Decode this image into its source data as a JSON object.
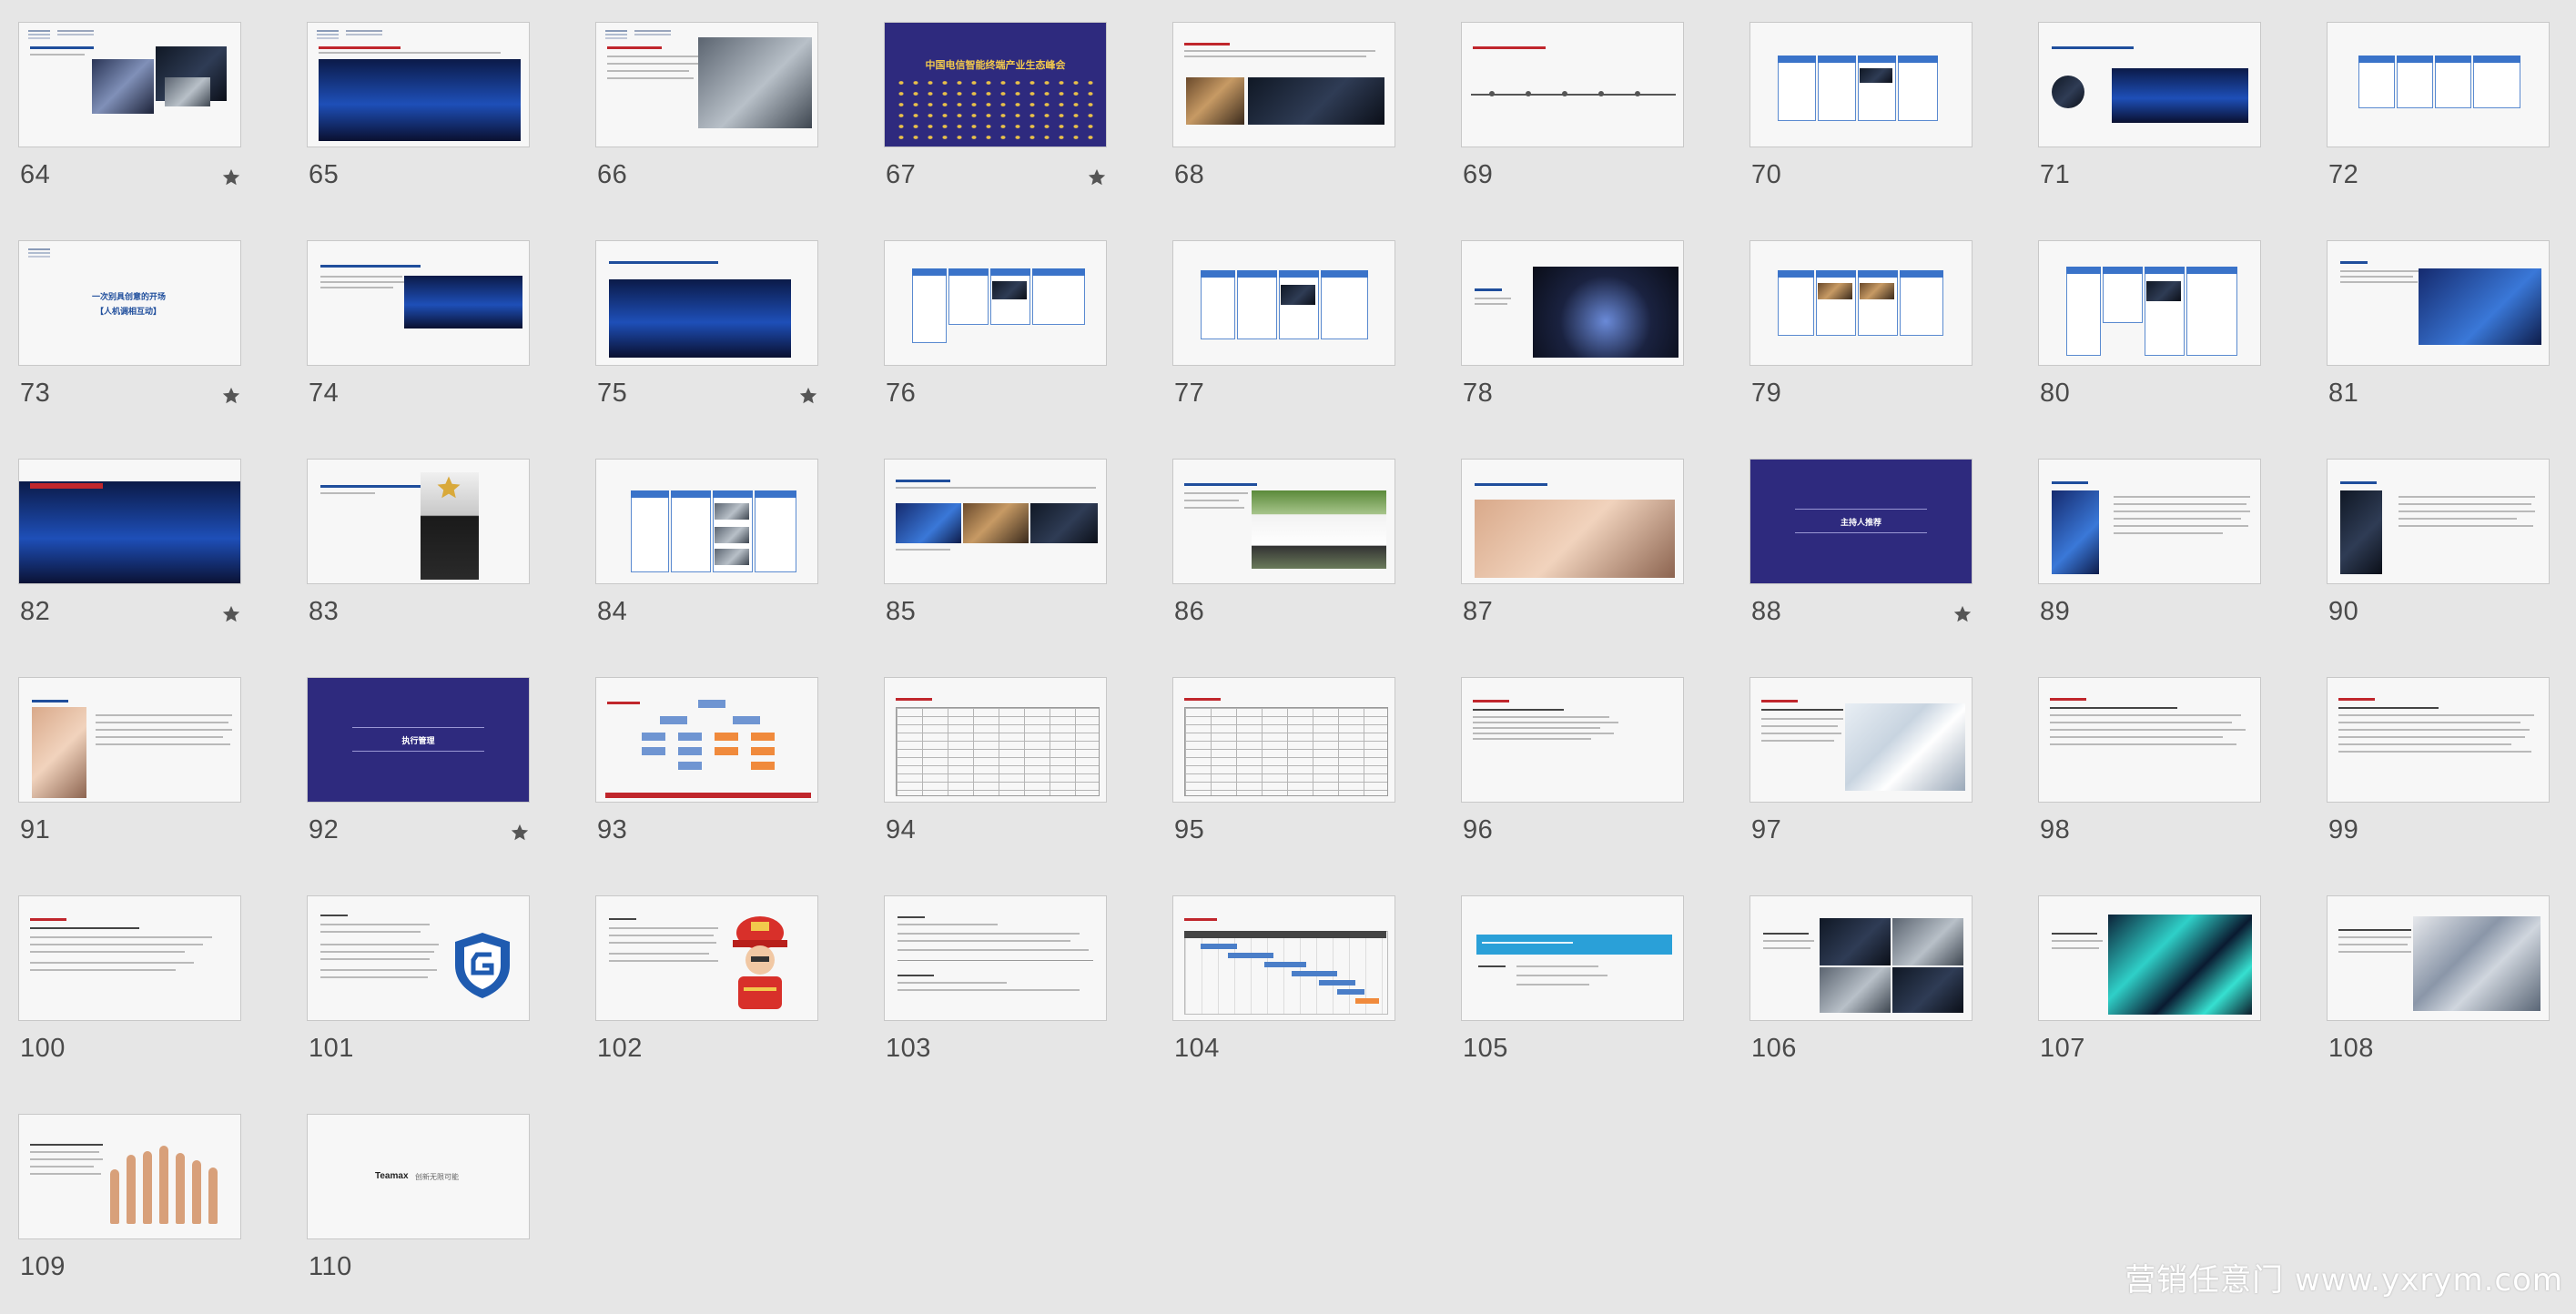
{
  "slides": [
    {
      "number": "64",
      "starred": true
    },
    {
      "number": "65",
      "starred": false
    },
    {
      "number": "66",
      "starred": false
    },
    {
      "number": "67",
      "starred": true,
      "thumb_text": "中国电信智能终端产业生态峰会"
    },
    {
      "number": "68",
      "starred": false
    },
    {
      "number": "69",
      "starred": false
    },
    {
      "number": "70",
      "starred": false
    },
    {
      "number": "71",
      "starred": false
    },
    {
      "number": "72",
      "starred": false
    },
    {
      "number": "73",
      "starred": true,
      "thumb_text": "一次别具创意的开场",
      "thumb_text2": "【人机调相互动】"
    },
    {
      "number": "74",
      "starred": false
    },
    {
      "number": "75",
      "starred": true
    },
    {
      "number": "76",
      "starred": false
    },
    {
      "number": "77",
      "starred": false
    },
    {
      "number": "78",
      "starred": false
    },
    {
      "number": "79",
      "starred": false
    },
    {
      "number": "80",
      "starred": false
    },
    {
      "number": "81",
      "starred": false
    },
    {
      "number": "82",
      "starred": true
    },
    {
      "number": "83",
      "starred": false
    },
    {
      "number": "84",
      "starred": false
    },
    {
      "number": "85",
      "starred": false
    },
    {
      "number": "86",
      "starred": false
    },
    {
      "number": "87",
      "starred": false
    },
    {
      "number": "88",
      "starred": true,
      "thumb_text": "主持人推荐"
    },
    {
      "number": "89",
      "starred": false
    },
    {
      "number": "90",
      "starred": false
    },
    {
      "number": "91",
      "starred": false
    },
    {
      "number": "92",
      "starred": true,
      "thumb_text": "执行管理"
    },
    {
      "number": "93",
      "starred": false
    },
    {
      "number": "94",
      "starred": false
    },
    {
      "number": "95",
      "starred": false
    },
    {
      "number": "96",
      "starred": false
    },
    {
      "number": "97",
      "starred": false
    },
    {
      "number": "98",
      "starred": false
    },
    {
      "number": "99",
      "starred": false
    },
    {
      "number": "100",
      "starred": false
    },
    {
      "number": "101",
      "starred": false
    },
    {
      "number": "102",
      "starred": false
    },
    {
      "number": "103",
      "starred": false
    },
    {
      "number": "104",
      "starred": false
    },
    {
      "number": "105",
      "starred": false
    },
    {
      "number": "106",
      "starred": false
    },
    {
      "number": "107",
      "starred": false
    },
    {
      "number": "108",
      "starred": false
    },
    {
      "number": "109",
      "starred": false
    },
    {
      "number": "110",
      "starred": false,
      "thumb_text": "Teamax",
      "thumb_text2": "创新无限可能"
    }
  ],
  "watermark": "营销任意门 www.yxrym.com",
  "colors": {
    "background": "#e6e6e6",
    "thumb_bg": "#f7f7f7",
    "accent_blue": "#1f4e9c",
    "accent_red": "#c0262c",
    "section_purple": "#2e2a7e",
    "slide_number": "#4a4a4a",
    "star": "#555555"
  },
  "icons": {
    "star": "star-icon"
  }
}
